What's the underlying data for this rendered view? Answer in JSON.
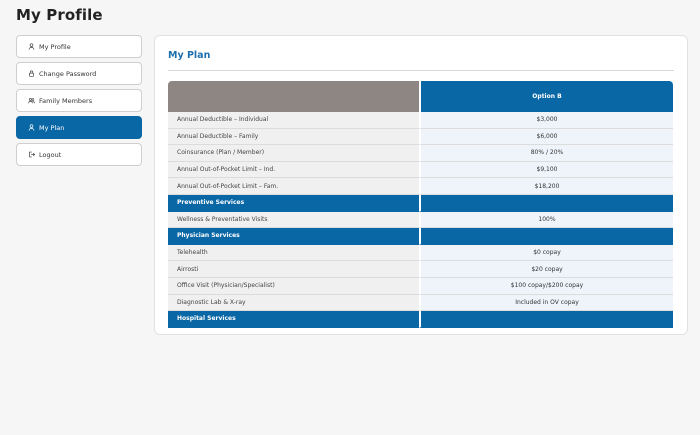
{
  "page": {
    "title": "My Profile"
  },
  "sidebar": {
    "items": [
      {
        "label": "My Profile",
        "icon": "user-icon",
        "active": false
      },
      {
        "label": "Change Password",
        "icon": "lock-icon",
        "active": false
      },
      {
        "label": "Family Members",
        "icon": "users-icon",
        "active": false
      },
      {
        "label": "My Plan",
        "icon": "user-icon",
        "active": true
      },
      {
        "label": "Logout",
        "icon": "logout-icon",
        "active": false
      }
    ]
  },
  "plan": {
    "title": "My Plan",
    "header_left": "",
    "header_right": "Option B",
    "rows": [
      {
        "type": "row",
        "label": "Annual Deductible – Individual",
        "value": "$3,000"
      },
      {
        "type": "row",
        "label": "Annual Deductible – Family",
        "value": "$6,000"
      },
      {
        "type": "row",
        "label": "Coinsurance (Plan / Member)",
        "value": "80% / 20%"
      },
      {
        "type": "row",
        "label": "Annual Out-of-Pocket Limit – Ind.",
        "value": "$9,100"
      },
      {
        "type": "row",
        "label": "Annual Out-of-Pocket Limit – Fam.",
        "value": "$18,200"
      },
      {
        "type": "section",
        "label": "Preventive Services",
        "value": ""
      },
      {
        "type": "row",
        "label": "Wellness & Preventative Visits",
        "value": "100%"
      },
      {
        "type": "section",
        "label": "Physician Services",
        "value": ""
      },
      {
        "type": "row",
        "label": "Telehealth",
        "value": "$0 copay"
      },
      {
        "type": "row",
        "label": "Airrosti",
        "value": "$20 copay"
      },
      {
        "type": "row",
        "label": "Office Visit (Physician/Specialist)",
        "value": "$100 copay/$200 copay"
      },
      {
        "type": "row",
        "label": "Diagnostic Lab & X-ray",
        "value": "Included in OV copay"
      },
      {
        "type": "section",
        "label": "Hospital Services",
        "value": ""
      }
    ]
  },
  "colors": {
    "accent": "#0a67a6",
    "header_gray": "#8d8683",
    "title_blue": "#1f6fad"
  }
}
